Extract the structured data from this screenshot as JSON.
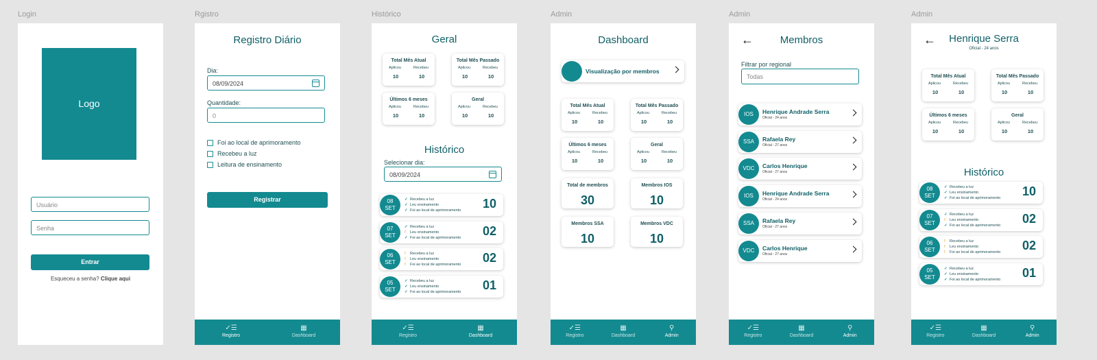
{
  "frame_labels": [
    "Login",
    "Rgistro",
    "Histórico",
    "Admin",
    "Admin",
    "Admin"
  ],
  "login": {
    "logo": "Logo",
    "user_ph": "Usuário",
    "pass_ph": "Senha",
    "enter": "Entrar",
    "forgot": "Esqueceu a senha?",
    "click": "Clique aqui"
  },
  "registro": {
    "title": "Registro Diário",
    "dia_label": "Dia:",
    "dia_value": "08/09/2024",
    "qtd_label": "Quantidade:",
    "qtd_value": "0",
    "checks": [
      "Foi ao local de aprimoramento",
      "Recebeu a luz",
      "Leitura de ensinamento"
    ],
    "submit": "Registrar"
  },
  "nav": {
    "registro": "Registro",
    "dashboard": "Dashboard",
    "dashboard_active": "Dashboard",
    "admin": "Admin"
  },
  "stats": {
    "aplicou": "Aplicou",
    "recebeu": "Recebeu",
    "cards": [
      {
        "title": "Total Mês Atual",
        "a": "10",
        "r": "10"
      },
      {
        "title": "Total Mês Passado",
        "a": "10",
        "r": "10"
      },
      {
        "title": "Últimos 6 meses",
        "a": "10",
        "r": "10"
      },
      {
        "title": "Geral",
        "a": "10",
        "r": "10"
      }
    ]
  },
  "historico": {
    "geral_title": "Geral",
    "title": "Histórico",
    "select_label": "Selecionar dia:",
    "date": "08/09/2024",
    "entries": [
      {
        "day": "08",
        "mon": "SET",
        "items": [
          "Recebeu a luz",
          "Leu ensinamento",
          "Foi ao local de aprimoramento"
        ],
        "status": [
          "ok",
          "ok",
          "ok"
        ],
        "num": "10"
      },
      {
        "day": "07",
        "mon": "SET",
        "items": [
          "Recebeu a luz",
          "Leu ensinamento",
          "Foi ao local de aprimoramento"
        ],
        "status": [
          "ok",
          "no",
          "ok"
        ],
        "num": "02"
      },
      {
        "day": "06",
        "mon": "SET",
        "items": [
          "Recebeu a luz",
          "Leu ensinamento",
          "Foi ao local de aprimoramento"
        ],
        "status": [
          "no",
          "no",
          "no"
        ],
        "num": "02"
      },
      {
        "day": "05",
        "mon": "SET",
        "items": [
          "Recebeu a luz",
          "Leu ensinamento",
          "Foi ao local de aprimoramento"
        ],
        "status": [
          "ok",
          "ok",
          "ok"
        ],
        "num": "01"
      }
    ]
  },
  "dashboard": {
    "title": "Dashboard",
    "vis": "Visualização por membros",
    "totals": [
      {
        "title": "Total de membros",
        "v": "30"
      },
      {
        "title": "Membros IOS",
        "v": "10"
      },
      {
        "title": "Membros SSA",
        "v": "10"
      },
      {
        "title": "Membros VDC",
        "v": "10"
      }
    ]
  },
  "membros": {
    "title": "Membros",
    "filter_label": "Filtrar por regional",
    "filter_ph": "Todas",
    "list": [
      {
        "ini": "IOS",
        "name": "Henrique Andrade Serra",
        "sub": "Oficial - 24 anos"
      },
      {
        "ini": "SSA",
        "name": "Rafaela Rey",
        "sub": "Oficial - 27 anos"
      },
      {
        "ini": "VDC",
        "name": "Carlos Henrique",
        "sub": "Oficial - 27 anos"
      },
      {
        "ini": "IOS",
        "name": "Henrique Andrade Serra",
        "sub": "Oficial - 24 anos"
      },
      {
        "ini": "SSA",
        "name": "Rafaela Rey",
        "sub": "Oficial - 27 anos"
      },
      {
        "ini": "VDC",
        "name": "Carlos Henrique",
        "sub": "Oficial - 27 anos"
      }
    ]
  },
  "perfil": {
    "name": "Henrique Serra",
    "sub": "Oficial - 24 anos"
  }
}
